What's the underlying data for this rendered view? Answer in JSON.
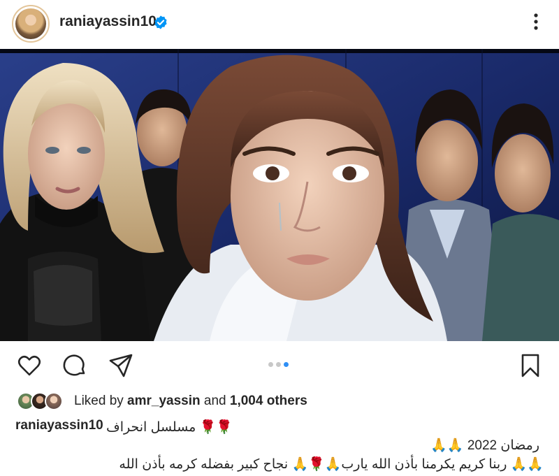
{
  "post": {
    "username": "raniayassin10",
    "verified_icon": "verified-badge-icon",
    "more_icon": "more-vertical-icon"
  },
  "actions": {
    "like_icon": "heart-icon",
    "comment_icon": "comment-icon",
    "share_icon": "send-icon",
    "save_icon": "bookmark-icon",
    "carousel_count": 3,
    "carousel_active_index": 2
  },
  "likes": {
    "prefix": "Liked by ",
    "user": "amr_yassin",
    "middle": " and ",
    "others": "1,004 others"
  },
  "caption": {
    "username": "raniayassin10",
    "line1": "🌹🌹 مسلسل انحراف",
    "line2": "رمضان 2022 🙏🙏",
    "line3": "🙏🙏 ربنا كريم  يكرمنا بأذن الله يارب🙏🌹🙏 نجاح كبير بفضله كرمه بأذن الله"
  },
  "colors": {
    "accent_blue": "#2f8ff5",
    "verified_blue": "#0095f6",
    "text": "#262626"
  }
}
